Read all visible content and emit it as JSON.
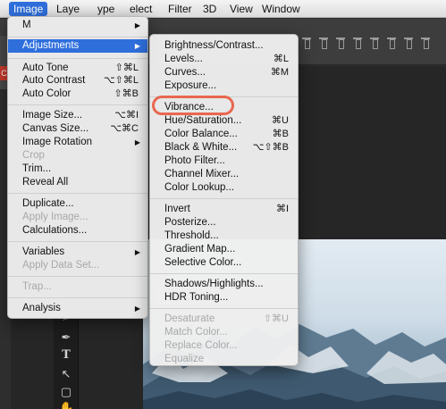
{
  "menubar": {
    "items": [
      "Image",
      "Laye",
      "ype",
      "elect",
      "Filter",
      "3D",
      "View",
      "Window"
    ]
  },
  "left_strip": {
    "c_label": "C"
  },
  "image_menu": {
    "top_stub": "M",
    "items": [
      {
        "label": "Adjustments",
        "submenu": true
      },
      {
        "label": "Auto Tone",
        "shortcut": "⇧⌘L"
      },
      {
        "label": "Auto Contrast",
        "shortcut": "⌥⇧⌘L"
      },
      {
        "label": "Auto Color",
        "shortcut": "⇧⌘B"
      },
      {
        "label": "Image Size...",
        "shortcut": "⌥⌘I"
      },
      {
        "label": "Canvas Size...",
        "shortcut": "⌥⌘C"
      },
      {
        "label": "Image Rotation",
        "submenu": true
      },
      {
        "label": "Crop",
        "disabled": true
      },
      {
        "label": "Trim..."
      },
      {
        "label": "Reveal All"
      },
      {
        "label": "Duplicate..."
      },
      {
        "label": "Apply Image...",
        "disabled": true
      },
      {
        "label": "Calculations..."
      },
      {
        "label": "Variables",
        "submenu": true
      },
      {
        "label": "Apply Data Set...",
        "disabled": true
      },
      {
        "label": "Trap...",
        "disabled": true
      },
      {
        "label": "Analysis",
        "submenu": true
      }
    ]
  },
  "adjustments_menu": {
    "items": [
      {
        "label": "Brightness/Contrast..."
      },
      {
        "label": "Levels...",
        "shortcut": "⌘L"
      },
      {
        "label": "Curves...",
        "shortcut": "⌘M"
      },
      {
        "label": "Exposure..."
      },
      {
        "label": "Vibrance..."
      },
      {
        "label": "Hue/Saturation...",
        "shortcut": "⌘U"
      },
      {
        "label": "Color Balance...",
        "shortcut": "⌘B"
      },
      {
        "label": "Black & White...",
        "shortcut": "⌥⇧⌘B"
      },
      {
        "label": "Photo Filter..."
      },
      {
        "label": "Channel Mixer..."
      },
      {
        "label": "Color Lookup..."
      },
      {
        "label": "Invert",
        "shortcut": "⌘I"
      },
      {
        "label": "Posterize..."
      },
      {
        "label": "Threshold..."
      },
      {
        "label": "Gradient Map..."
      },
      {
        "label": "Selective Color..."
      },
      {
        "label": "Shadows/Highlights..."
      },
      {
        "label": "HDR Toning..."
      },
      {
        "label": "Desaturate",
        "shortcut": "⇧⌘U",
        "disabled": true
      },
      {
        "label": "Match Color...",
        "disabled": true
      },
      {
        "label": "Replace Color...",
        "disabled": true
      },
      {
        "label": "Equalize",
        "disabled": true
      }
    ]
  },
  "submenu_arrow": "▶",
  "colors": {
    "highlight": "#2f6fdc",
    "annotation_circle": "#e8674f"
  }
}
